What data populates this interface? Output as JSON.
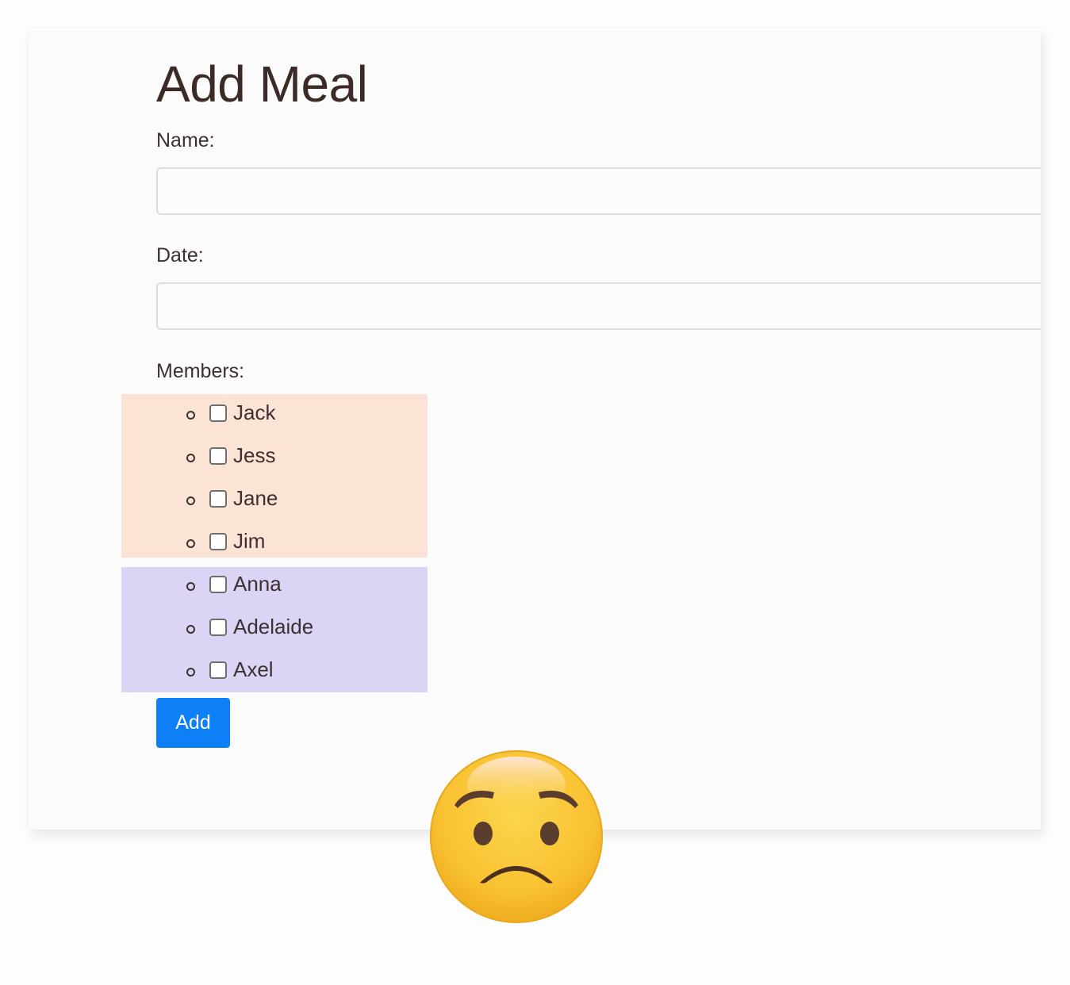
{
  "form": {
    "title": "Add Meal",
    "name_label": "Name:",
    "name_value": "",
    "date_label": "Date:",
    "date_value": "",
    "members_label": "Members:",
    "submit_label": "Add"
  },
  "members": {
    "group_a": [
      {
        "name": "Jack",
        "checked": false
      },
      {
        "name": "Jess",
        "checked": false
      },
      {
        "name": "Jane",
        "checked": false
      },
      {
        "name": "Jim",
        "checked": false
      }
    ],
    "group_b": [
      {
        "name": "Anna",
        "checked": false
      },
      {
        "name": "Adelaide",
        "checked": false
      },
      {
        "name": "Axel",
        "checked": false
      }
    ]
  },
  "colors": {
    "group_a_bg": "#fbe3d6",
    "group_b_bg": "#dcd4f5",
    "button_bg": "#0d7ff7",
    "text": "#3e3030"
  },
  "decoration": {
    "emoji": "worried-face-icon"
  }
}
